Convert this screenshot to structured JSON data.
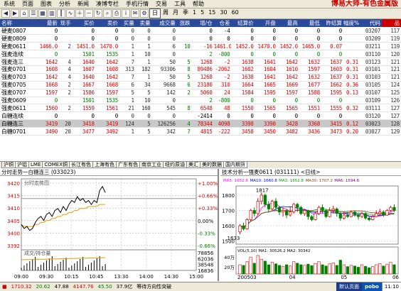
{
  "menu": [
    "系统",
    "页面",
    "图表",
    "分析",
    "新闻",
    "凑博专栏",
    "手机行情",
    "交易",
    "工具",
    "帮助"
  ],
  "brand": "博易大师-有色金属版",
  "toolbar": {
    "periods": [
      "日",
      "周",
      "月",
      "季",
      "1",
      "5",
      "15",
      "30",
      "60"
    ],
    "selected_period": "日"
  },
  "quote_table": {
    "headers": [
      "名称",
      "最新",
      "现手",
      "买价",
      "卖价",
      "买量",
      "卖量",
      "成交量",
      "涨跌",
      "增/仓",
      "仓差",
      "结算价",
      "开盘",
      "最高",
      "最低",
      "昨结算",
      "幅度%",
      "代码",
      "品"
    ],
    "rows": [
      {
        "name": "硬麦0807",
        "c": [
          "0",
          "",
          "0",
          "0",
          "0",
          "0",
          "0",
          "",
          "0",
          "-4",
          "0",
          "0",
          "0",
          "0",
          "0",
          "",
          "03207",
          "117"
        ],
        "color": "eq"
      },
      {
        "name": "硬麦0809",
        "c": [
          "0",
          "",
          "0",
          "0",
          "0",
          "0",
          "0",
          "",
          "0",
          "0",
          "0",
          "0",
          "0",
          "0",
          "0",
          "",
          "03209",
          "119"
        ],
        "color": "eq"
      },
      {
        "name": "硬麦0611",
        "c": [
          "1466.0",
          "2",
          "1451.0",
          "1470.0",
          "1",
          "1",
          "6",
          "10",
          "-16",
          "1461.0",
          "1452.0",
          "1470.0",
          "1452.0",
          "1465.0",
          "0.07",
          "",
          "03211",
          "119"
        ],
        "color": "up"
      },
      {
        "name": "强麦连续",
        "c": [
          "0",
          "",
          "1501",
          "1535",
          "1",
          "10",
          "0",
          "",
          "2",
          "-800",
          "0",
          "0",
          "0",
          "0",
          "0",
          "",
          "03110",
          "120"
        ],
        "color": "dn"
      },
      {
        "name": "强麦连三",
        "c": [
          "1642",
          "4",
          "1640",
          "1642",
          "7",
          "1",
          "50",
          "5",
          "1268",
          "-2",
          "1638",
          "1641",
          "1642",
          "1632",
          "1637",
          "0.31",
          "03123",
          "121"
        ],
        "color": "up"
      },
      {
        "name": "强麦0701",
        "c": [
          "1608",
          "4",
          "1607",
          "1608",
          "313",
          "182",
          "93306",
          "8",
          "89486",
          "-2062",
          "1602",
          "1604",
          "1610",
          "1597",
          "1603",
          "0.31",
          "03101",
          "121"
        ],
        "color": "up"
      },
      {
        "name": "强麦0703",
        "c": [
          "1642",
          "4",
          "1640",
          "1642",
          "7",
          "1",
          "50",
          "5",
          "1268",
          "-2",
          "1638",
          "1641",
          "1642",
          "1632",
          "1637",
          "0.31",
          "03103",
          "121"
        ],
        "color": "up"
      },
      {
        "name": "强麦0705",
        "c": [
          "1668",
          "2",
          "1667",
          "1668",
          "6",
          "34",
          "9668",
          "6",
          "23180",
          "310",
          "1664",
          "1665",
          "1669",
          "1677",
          "1662",
          "0.36",
          "03105",
          "124"
        ],
        "color": "up"
      },
      {
        "name": "强麦0707",
        "c": [
          "1597",
          "2",
          "1586",
          "1597",
          "5",
          "5",
          "142",
          "2",
          "5060",
          "24",
          "1584",
          "1595",
          "1597",
          "1588",
          "1595",
          "0.13",
          "03107",
          "125"
        ],
        "color": "up"
      },
      {
        "name": "强麦0609",
        "c": [
          "0",
          "",
          "1501",
          "1535",
          "1",
          "10",
          "0",
          "",
          "2",
          "-800",
          "0",
          "0",
          "0",
          "0",
          "0",
          "",
          "03109",
          "126"
        ],
        "color": "dn"
      },
      {
        "name": "强麦0611",
        "c": [
          "1560",
          "2",
          "1559",
          "1561",
          "21",
          "160",
          "545",
          "8",
          "6548",
          "48",
          "1550",
          "1565",
          "1565",
          "1551",
          "1555",
          "0.32",
          "03111",
          "127"
        ],
        "color": "up"
      },
      {
        "name": "白糖连续",
        "c": [
          "0",
          "",
          "0",
          "0",
          "0",
          "0",
          "0",
          "",
          "-2414",
          "0",
          "0",
          "0",
          "0",
          "0",
          "0",
          "",
          "03120",
          "127"
        ],
        "color": "eq"
      },
      {
        "name": "白糖连三",
        "c": [
          "3419",
          "20",
          "3418",
          "3419",
          "124",
          "5",
          "126256",
          "4",
          "78344",
          "4098",
          "3398",
          "3390",
          "3428",
          "3368",
          "3415",
          "0.12",
          "03023",
          "128"
        ],
        "color": "up",
        "selected": true
      },
      {
        "name": "白糖0701",
        "c": [
          "3490",
          "20",
          "3477",
          "3492",
          "1",
          "5",
          "342",
          "7",
          "4815",
          "-222",
          "3458",
          "3450",
          "3482",
          "3436",
          "3473",
          "0.20",
          "03027",
          "129"
        ],
        "color": "up"
      }
    ]
  },
  "tabs": [
    "沪铜",
    "沪铝",
    "LME",
    "COMEX铜",
    "长江有色",
    "上海有色",
    "广东有色",
    "南京工业",
    "纽约原油",
    "美汇",
    "美的数据",
    "国内期货"
  ],
  "intraday": {
    "title": "分时走势一白糖连三 (033023)",
    "subtitle": "分时走势图",
    "y_labels": [
      "3420",
      "3415",
      "3410",
      "3405",
      "3400",
      "3392"
    ],
    "y_labels_right": [
      "+1.00%",
      "+0.66%",
      "+0.33%",
      "0.00%",
      "-0.33%",
      "-0.66%"
    ],
    "volume_label": "成交/持仓量",
    "vol_labels": [
      "78856",
      "62036",
      "38548",
      "16836"
    ],
    "time_labels": [
      "09:00",
      "09:30",
      "10:15",
      "10:45",
      "13:30",
      "14:00",
      "14:30",
      "15:00"
    ],
    "price_series": [
      3402,
      3400,
      3401,
      3399,
      3400,
      3403,
      3405,
      3406,
      3404,
      3407,
      3408,
      3406,
      3409,
      3410,
      3408,
      3411,
      3409,
      3412,
      3414,
      3413,
      3416,
      3414,
      3415,
      3413,
      3414,
      3412,
      3414,
      3413,
      3419,
      3421,
      3418
    ],
    "avg_series": [
      3402,
      3401,
      3401,
      3401,
      3401,
      3402,
      3402,
      3403,
      3403,
      3404,
      3404,
      3405,
      3405,
      3406,
      3406,
      3407,
      3407,
      3408,
      3408,
      3409,
      3409,
      3410,
      3410,
      3410,
      3411,
      3411,
      3411,
      3411,
      3412,
      3412,
      3412
    ],
    "baseline": 3415,
    "ylim": [
      3390,
      3422
    ]
  },
  "kline": {
    "title": "技术分析一强麦0611 (031111) <日线>",
    "ma_legend": [
      {
        "label": "MA5: 1652.8",
        "color": "#ff00ff"
      },
      {
        "label": "MA10: 1660.8",
        "color": "#0000ff"
      },
      {
        "label": "MA3: 1652.8",
        "color": "#00a000"
      },
      {
        "label": "MA30: 1707.2",
        "color": "#8b4513"
      },
      {
        "label": "MA6: 1594.6",
        "color": "#800080"
      }
    ],
    "y_labels": [
      "1800",
      "1700",
      "1600",
      "1500"
    ],
    "high_label": "1817",
    "low_label": "1633",
    "vol_legend": "VOL(5,10)  MA1: 30526.2  MA2: 30342",
    "vol_y_labels": [
      "40万",
      "20万"
    ],
    "date_labels": [
      "200503",
      "04",
      "05",
      "06"
    ],
    "ylim": [
      1480,
      1860
    ],
    "candles": [
      [
        1560,
        1600,
        1545,
        1610
      ],
      [
        1600,
        1580,
        1570,
        1620
      ],
      [
        1580,
        1640,
        1575,
        1650
      ],
      [
        1640,
        1700,
        1630,
        1710
      ],
      [
        1700,
        1680,
        1660,
        1720
      ],
      [
        1680,
        1760,
        1670,
        1780
      ],
      [
        1760,
        1800,
        1740,
        1817
      ],
      [
        1800,
        1740,
        1720,
        1810
      ],
      [
        1740,
        1710,
        1690,
        1760
      ],
      [
        1710,
        1760,
        1700,
        1770
      ],
      [
        1760,
        1720,
        1700,
        1780
      ],
      [
        1720,
        1690,
        1670,
        1730
      ],
      [
        1690,
        1700,
        1660,
        1720
      ],
      [
        1700,
        1670,
        1650,
        1710
      ],
      [
        1670,
        1690,
        1660,
        1720
      ],
      [
        1690,
        1740,
        1680,
        1750
      ],
      [
        1740,
        1720,
        1690,
        1750
      ],
      [
        1720,
        1680,
        1670,
        1730
      ],
      [
        1680,
        1700,
        1665,
        1710
      ],
      [
        1700,
        1660,
        1640,
        1705
      ],
      [
        1660,
        1640,
        1630,
        1670
      ],
      [
        1640,
        1680,
        1635,
        1690
      ],
      [
        1680,
        1720,
        1670,
        1730
      ],
      [
        1720,
        1700,
        1680,
        1740
      ],
      [
        1700,
        1660,
        1650,
        1710
      ],
      [
        1660,
        1700,
        1655,
        1720
      ],
      [
        1700,
        1710,
        1680,
        1730
      ],
      [
        1710,
        1680,
        1660,
        1720
      ],
      [
        1680,
        1650,
        1633,
        1690
      ],
      [
        1650,
        1670,
        1640,
        1690
      ],
      [
        1670,
        1660,
        1650,
        1690
      ],
      [
        1660,
        1690,
        1655,
        1700
      ],
      [
        1690,
        1670,
        1660,
        1700
      ],
      [
        1670,
        1660,
        1640,
        1680
      ],
      [
        1660,
        1680,
        1650,
        1690
      ],
      [
        1680,
        1650,
        1640,
        1690
      ],
      [
        1650,
        1640,
        1630,
        1660
      ],
      [
        1640,
        1660,
        1635,
        1670
      ],
      [
        1660,
        1680,
        1655,
        1700
      ],
      [
        1680,
        1690,
        1670,
        1710
      ],
      [
        1690,
        1670,
        1660,
        1700
      ],
      [
        1670,
        1700,
        1665,
        1710
      ],
      [
        1700,
        1720,
        1690,
        1730
      ],
      [
        1720,
        1700,
        1690,
        1740
      ]
    ],
    "volumes": [
      30,
      28,
      40,
      55,
      35,
      60,
      48,
      42,
      30,
      38,
      33,
      28,
      25,
      30,
      26,
      40,
      35,
      30,
      28,
      32,
      27,
      34,
      40,
      30,
      26,
      33,
      36,
      28,
      45,
      30,
      24,
      28,
      26,
      22,
      30,
      25,
      20,
      24,
      30,
      34,
      26,
      32,
      38,
      30
    ]
  },
  "status": {
    "items": [
      "1710.32",
      "20.62",
      "47.88",
      "4147.76",
      "45.50",
      "37.9亿"
    ],
    "item_colors": [
      "#e00000",
      "#008000",
      "#000000",
      "#e00000",
      "#008000",
      "#000000"
    ],
    "message": "等待方向性突破",
    "right_badge": "默认页面",
    "logo": "pobo",
    "time": "11:10"
  }
}
